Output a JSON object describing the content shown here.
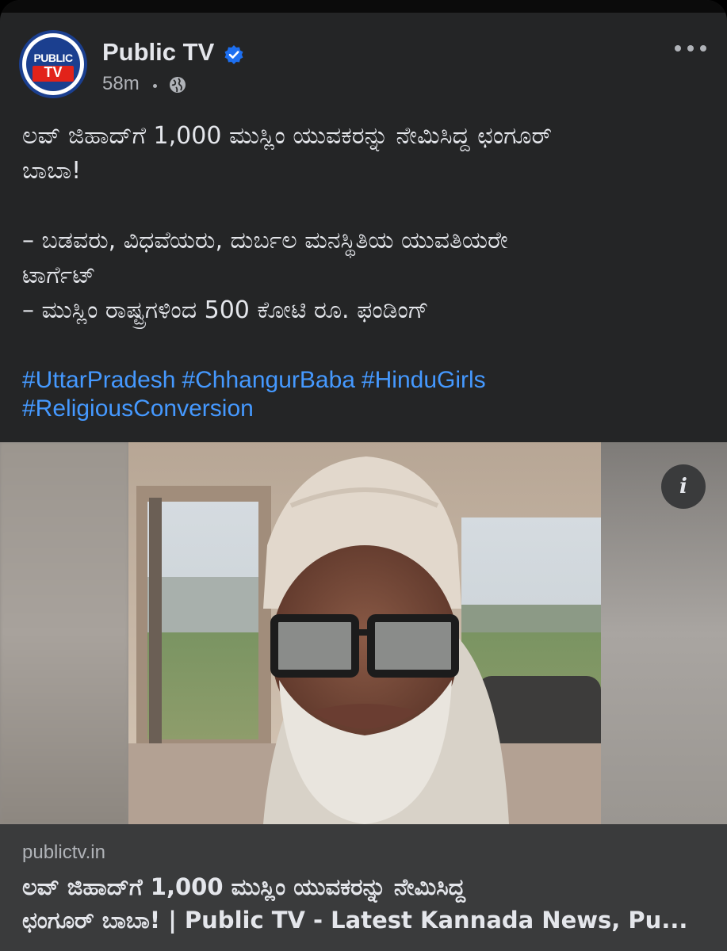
{
  "post": {
    "page_name": "Public TV",
    "verified_icon": "verified-badge-icon",
    "time": "58m",
    "audience_icon": "globe-icon",
    "more_icon": "more-options-icon",
    "text_line_1": "ಲವ್ ಜಿಹಾದ್‌ಗೆ 1,000 ಮುಸ್ಲಿಂ ಯುವಕರನ್ನು ನೇಮಿಸಿದ್ದ ಛಂಗೂರ್",
    "text_line_2": "ಬಾಬಾ!",
    "text_line_3": "– ಬಡವರು, ವಿಧವೆಯರು, ದುರ್ಬಲ ಮನಸ್ಥಿತಿಯ ಯುವತಿಯರೇ",
    "text_line_4": "ಟಾರ್ಗೆಟ್",
    "text_line_5": "– ಮುಸ್ಲಿಂ ರಾಷ್ಟ್ರಗಳಿಂದ 500 ಕೋಟಿ ರೂ. ಫಂಡಿಂಗ್",
    "hashtags": [
      "#UttarPradesh",
      "#ChhangurBaba",
      "#HinduGirls",
      "#ReligiousConversion"
    ]
  },
  "avatar": {
    "logo_top": "PUBLIC",
    "logo_bottom": "TV"
  },
  "image": {
    "info_label": "i"
  },
  "link": {
    "domain": "publictv.in",
    "title_line_1": "ಲವ್ ಜಿಹಾದ್‌ಗೆ 1,000 ಮುಸ್ಲಿಂ ಯುವಕರನ್ನು ನೇಮಿಸಿದ್ದ",
    "title_line_2": "ಛಂಗೂರ್ ಬಾಬಾ! | Public TV - Latest Kannada News, Pu..."
  },
  "colors": {
    "card_bg": "#242526",
    "text_primary": "#e4e6eb",
    "text_secondary": "#b0b3b8",
    "hashtag": "#4599ff",
    "verified": "#1d6ff0",
    "link_bg": "#3a3b3c"
  }
}
